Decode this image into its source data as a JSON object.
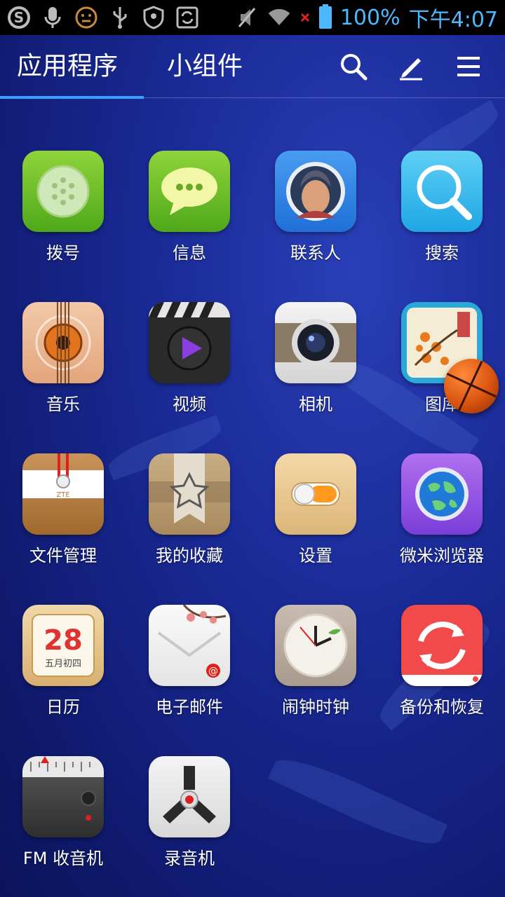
{
  "status_bar": {
    "battery_text": "100%",
    "time": "下午4:07",
    "icons": [
      "sogou-icon",
      "microphone-icon",
      "emoji-icon",
      "usb-icon",
      "shield-icon",
      "sync-icon",
      "mute-icon",
      "wifi-icon",
      "no-signal-icon",
      "battery-icon"
    ]
  },
  "tabs": {
    "apps_label": "应用程序",
    "widgets_label": "小组件"
  },
  "toolbar": {
    "icons": [
      "search-icon",
      "edit-icon",
      "menu-icon"
    ]
  },
  "apps": [
    {
      "label": "拨号",
      "icon": "dialer-icon"
    },
    {
      "label": "信息",
      "icon": "messages-icon"
    },
    {
      "label": "联系人",
      "icon": "contacts-icon"
    },
    {
      "label": "搜索",
      "icon": "search-app-icon"
    },
    {
      "label": "音乐",
      "icon": "music-icon"
    },
    {
      "label": "视频",
      "icon": "video-icon"
    },
    {
      "label": "相机",
      "icon": "camera-icon"
    },
    {
      "label": "图库",
      "icon": "gallery-icon"
    },
    {
      "label": "文件管理",
      "icon": "file-manager-icon"
    },
    {
      "label": "我的收藏",
      "icon": "favorites-icon"
    },
    {
      "label": "设置",
      "icon": "settings-icon"
    },
    {
      "label": "微米浏览器",
      "icon": "browser-icon"
    },
    {
      "label": "日历",
      "icon": "calendar-icon"
    },
    {
      "label": "电子邮件",
      "icon": "email-icon"
    },
    {
      "label": "闹钟时钟",
      "icon": "clock-icon"
    },
    {
      "label": "备份和恢复",
      "icon": "backup-icon"
    },
    {
      "label": "FM 收音机",
      "icon": "radio-icon"
    },
    {
      "label": "录音机",
      "icon": "recorder-icon"
    }
  ],
  "calendar_icon": {
    "day": "28",
    "lunar": "五月初四"
  },
  "file_manager_icon": {
    "brand": "ZTE"
  },
  "colors": {
    "accent": "#3aa0ff",
    "status_text": "#4db8ff"
  }
}
